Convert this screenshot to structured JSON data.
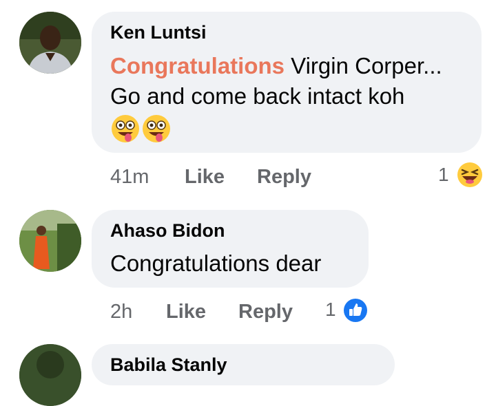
{
  "comments": [
    {
      "author": "Ken Luntsi",
      "highlight": "Congratulations",
      "text_line1": " Virgin Corper...",
      "text_line2": "Go and come back intact koh",
      "time": "41m",
      "like_label": "Like",
      "reply_label": "Reply",
      "reaction_count": "1",
      "reaction_icon": "haha-reaction-icon"
    },
    {
      "author": "Ahaso Bidon",
      "text_line1": "Congratulations dear",
      "time": "2h",
      "like_label": "Like",
      "reply_label": "Reply",
      "reaction_count": "1",
      "reaction_icon": "like-reaction-icon"
    },
    {
      "author": "Babila Stanly"
    }
  ],
  "colors": {
    "bubble": "#f0f2f5",
    "highlight": "#e9775b",
    "meta": "#65676b",
    "like_blue": "#1877f2"
  }
}
